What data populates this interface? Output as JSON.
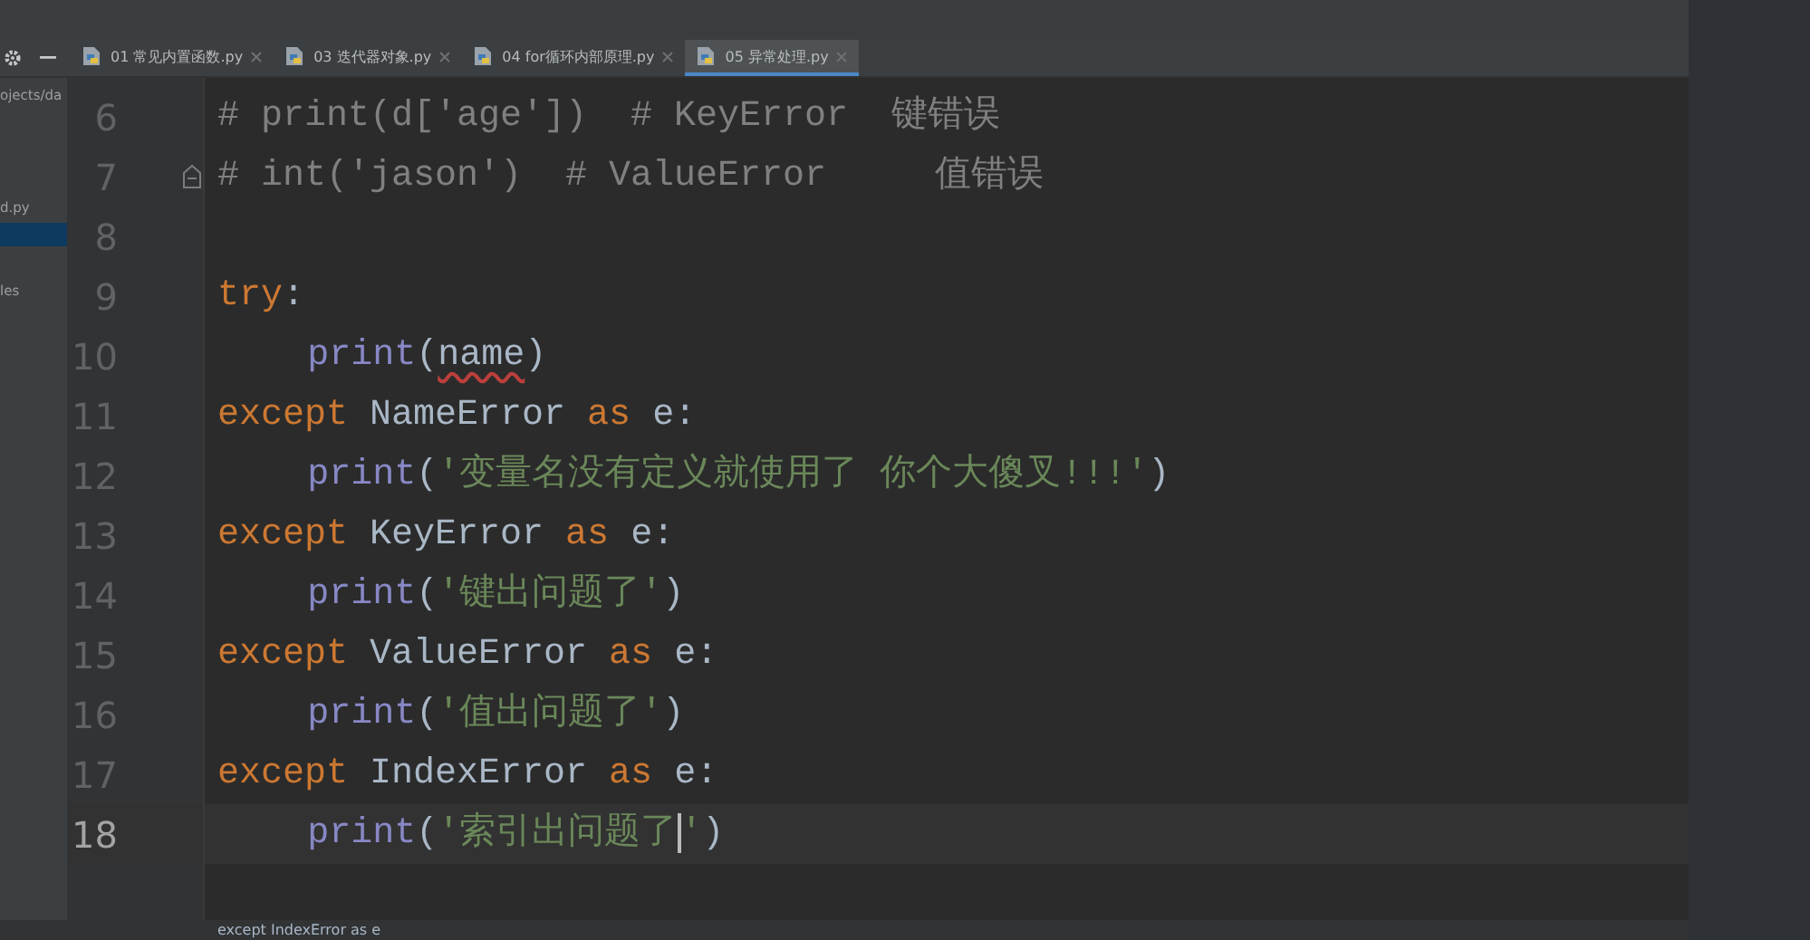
{
  "tabs": [
    {
      "label": "01 常见内置函数.py",
      "selected": false
    },
    {
      "label": "03 迭代器对象.py",
      "selected": false
    },
    {
      "label": "04 for循环内部原理.py",
      "selected": false
    },
    {
      "label": "05 异常处理.py",
      "selected": true
    }
  ],
  "sidebar": {
    "items": [
      {
        "label": "ojects/da",
        "selected": false
      },
      {
        "label": "d.py",
        "selected": false
      },
      {
        "selected": true
      },
      {
        "label": "les",
        "selected": false
      }
    ]
  },
  "editor": {
    "lines": [
      {
        "number": "6",
        "fold": false,
        "current": false,
        "segments": [
          {
            "kind": "comment",
            "text": "# print(d['age'])  # KeyError  键错误"
          }
        ]
      },
      {
        "number": "7",
        "fold": true,
        "current": false,
        "segments": [
          {
            "kind": "comment",
            "text": "# int('jason')  # ValueError     值错误"
          }
        ]
      },
      {
        "number": "8",
        "fold": false,
        "current": false
      },
      {
        "number": "9",
        "fold": false,
        "current": false,
        "segments": [
          {
            "kind": "keyword",
            "text": "try"
          },
          {
            "kind": "text",
            "text": ":"
          }
        ],
        "children": [
          {
            "number": "10",
            "fold": false,
            "current": false,
            "segments": [
              {
                "kind": "builtin",
                "text": "print"
              },
              {
                "kind": "text",
                "text": "("
              },
              {
                "kind": "error",
                "text": "name"
              },
              {
                "kind": "text",
                "text": ")"
              }
            ]
          }
        ]
      },
      {
        "number": "11",
        "fold": false,
        "current": false,
        "segments": [
          {
            "kind": "keyword",
            "text": "except "
          },
          {
            "kind": "text",
            "text": "NameError "
          },
          {
            "kind": "keyword",
            "text": "as "
          },
          {
            "kind": "text",
            "text": "e:"
          }
        ],
        "children": [
          {
            "number": "12",
            "fold": false,
            "current": false,
            "segments": [
              {
                "kind": "builtin",
                "text": "print"
              },
              {
                "kind": "text",
                "text": "("
              },
              {
                "kind": "string",
                "text": "'变量名没有定义就使用了 你个大傻叉!!!'"
              },
              {
                "kind": "text",
                "text": ")"
              }
            ]
          }
        ]
      },
      {
        "number": "13",
        "fold": false,
        "current": false,
        "segments": [
          {
            "kind": "keyword",
            "text": "except "
          },
          {
            "kind": "text",
            "text": "KeyError "
          },
          {
            "kind": "keyword",
            "text": "as "
          },
          {
            "kind": "text",
            "text": "e:"
          }
        ],
        "children": [
          {
            "number": "14",
            "fold": false,
            "current": false,
            "segments": [
              {
                "kind": "builtin",
                "text": "print"
              },
              {
                "kind": "text",
                "text": "("
              },
              {
                "kind": "string",
                "text": "'键出问题了'"
              },
              {
                "kind": "text",
                "text": ")"
              }
            ]
          }
        ]
      },
      {
        "number": "15",
        "fold": false,
        "current": false,
        "segments": [
          {
            "kind": "keyword",
            "text": "except "
          },
          {
            "kind": "text",
            "text": "ValueError "
          },
          {
            "kind": "keyword",
            "text": "as "
          },
          {
            "kind": "text",
            "text": "e:"
          }
        ],
        "children": [
          {
            "number": "16",
            "fold": false,
            "current": false,
            "segments": [
              {
                "kind": "builtin",
                "text": "print"
              },
              {
                "kind": "text",
                "text": "("
              },
              {
                "kind": "string",
                "text": "'值出问题了'"
              },
              {
                "kind": "text",
                "text": ")"
              }
            ]
          }
        ]
      },
      {
        "number": "17",
        "fold": false,
        "current": false,
        "segments": [
          {
            "kind": "keyword",
            "text": "except "
          },
          {
            "kind": "text",
            "text": "IndexError "
          },
          {
            "kind": "keyword",
            "text": "as "
          },
          {
            "kind": "text",
            "text": "e:"
          }
        ],
        "children": [
          {
            "number": "18",
            "fold": false,
            "current": true,
            "segments": [
              {
                "kind": "builtin",
                "text": "print"
              },
              {
                "kind": "text",
                "text": "("
              },
              {
                "kind": "string",
                "text": "'索引出问题了"
              },
              {
                "kind": "caret"
              },
              {
                "kind": "string",
                "text": "'"
              },
              {
                "kind": "text",
                "text": ")"
              }
            ]
          }
        ]
      }
    ]
  },
  "breadcrumb": "except IndexError as e"
}
